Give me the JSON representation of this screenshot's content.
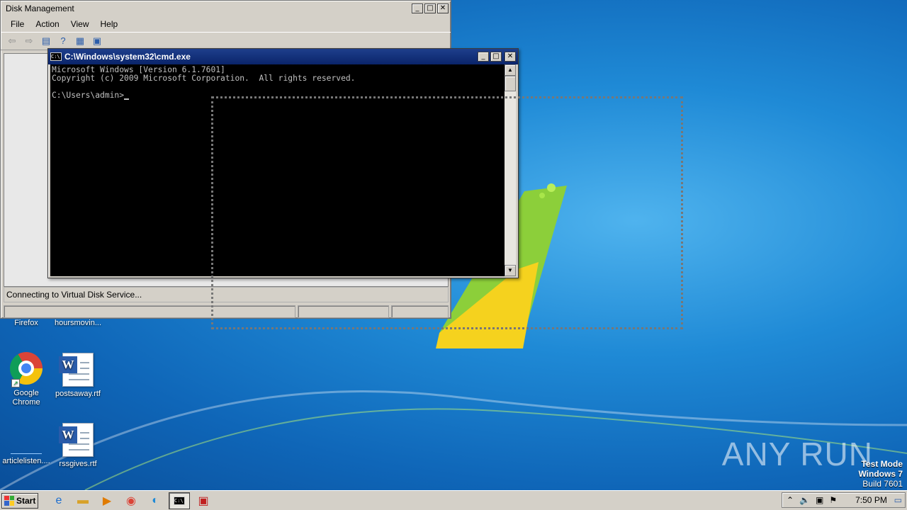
{
  "desktop": {
    "icons": [
      {
        "label": "Firefox"
      },
      {
        "label": "hoursmovin..."
      },
      {
        "label": "Google Chrome"
      },
      {
        "label": "postsaway.rtf"
      },
      {
        "label": "articlelisten...."
      },
      {
        "label": "rssgives.rtf"
      }
    ],
    "watermark": "ANY RUN",
    "test_mode": {
      "line1": "Test Mode",
      "line2": "Windows 7",
      "line3": "Build 7601"
    }
  },
  "disk_management": {
    "title": "Disk Management",
    "menu": [
      "File",
      "Action",
      "View",
      "Help"
    ],
    "status": "Connecting to Virtual Disk Service..."
  },
  "cmd": {
    "title": "C:\\Windows\\system32\\cmd.exe",
    "lines": [
      "Microsoft Windows [Version 6.1.7601]",
      "Copyright (c) 2009 Microsoft Corporation.  All rights reserved.",
      "",
      "C:\\Users\\admin>"
    ]
  },
  "taskbar": {
    "start": "Start",
    "clock": "7:50 PM"
  },
  "colors": {
    "cmd_title": "#0a246a",
    "desktop": "#1f8ad6"
  }
}
